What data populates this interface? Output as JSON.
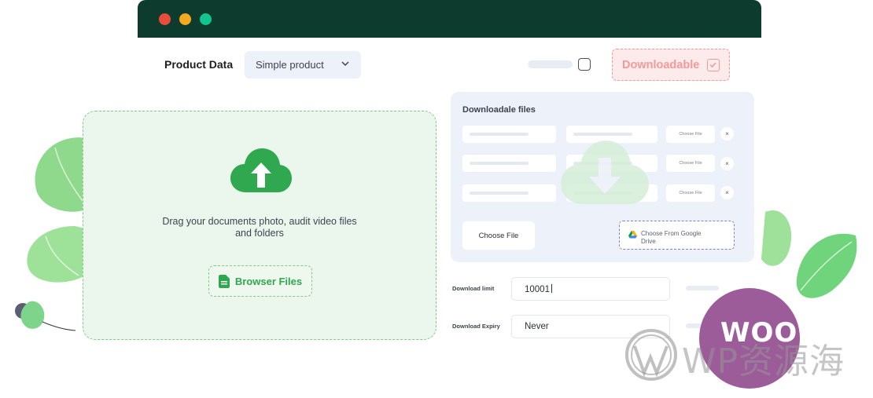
{
  "window": {
    "controls": [
      "close",
      "minimize",
      "maximize"
    ],
    "control_colors": [
      "#ea4c3c",
      "#f4aa1e",
      "#12c48e"
    ]
  },
  "product": {
    "label": "Product Data",
    "type_value": "Simple product"
  },
  "downloadable": {
    "label": "Downloadable"
  },
  "upload": {
    "line1": "Drag your documents photo, audit video files",
    "line2": "and folders",
    "browse_label": "Browser Files"
  },
  "files_panel": {
    "title": "Downloadale files",
    "rows": [
      {
        "choose_label": "Choose File",
        "remove": "×"
      },
      {
        "choose_label": "Choose File",
        "remove": "×"
      },
      {
        "choose_label": "Choose File",
        "remove": "×"
      }
    ],
    "choose_file_label": "Choose File",
    "gdrive_line1": "Choose From Google",
    "gdrive_line2": "Drive"
  },
  "fields": {
    "download_limit_label": "Download limit",
    "download_limit_value": "10001",
    "download_expiry_label": "Download Expiry",
    "download_expiry_value": "Never"
  },
  "badge": {
    "woo": "WOO"
  },
  "watermark": {
    "text": "WP资源海"
  },
  "colors": {
    "accent_green": "#2fa84f",
    "titlebar": "#0d3b2e",
    "woo_purple": "#9c5c9a",
    "badge_red": "#f29a9a"
  }
}
